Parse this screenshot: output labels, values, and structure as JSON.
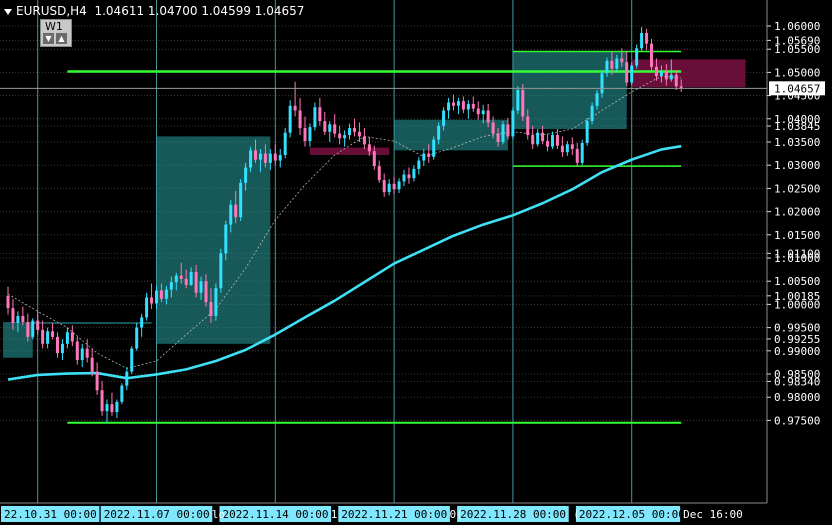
{
  "header": {
    "symbol_timeframe": "EURUSD,H4",
    "ohlc": "1.04611 1.04700 1.04599 1.04657"
  },
  "period_widget": {
    "label": "W1",
    "down_arrow": "▼",
    "up_arrow": "▲"
  },
  "colors": {
    "background": "#000000",
    "grid": "#5ec8d8",
    "bull": "#33e0ff",
    "bear": "#ff77bb",
    "ma": "#3ee0f5",
    "level": "#33ff33",
    "box_teal": "#2aa0a0",
    "box_maroon": "#7a1042",
    "axis_text": "#ffffff"
  },
  "chart_data": {
    "type": "candlestick",
    "symbol": "EURUSD",
    "timeframe": "H4",
    "ylim": [
      0.9712,
      1.0622
    ],
    "y_ticks": [
      {
        "value": 1.06,
        "label": "1.06000"
      },
      {
        "value": 1.0569,
        "label": "1.05690"
      },
      {
        "value": 1.055,
        "label": "1.05500"
      },
      {
        "value": 1.05,
        "label": "1.05000"
      },
      {
        "value": 1.045,
        "label": "1.04500"
      },
      {
        "value": 1.04,
        "label": "1.04000"
      },
      {
        "value": 1.03845,
        "label": "1.03845"
      },
      {
        "value": 1.035,
        "label": "1.03500"
      },
      {
        "value": 1.03,
        "label": "1.03000"
      },
      {
        "value": 1.025,
        "label": "1.02500"
      },
      {
        "value": 1.02,
        "label": "1.02000"
      },
      {
        "value": 1.015,
        "label": "1.01500"
      },
      {
        "value": 1.011,
        "label": "1.01100"
      },
      {
        "value": 1.01,
        "label": "1.01000"
      },
      {
        "value": 1.005,
        "label": "1.00500"
      },
      {
        "value": 1.00185,
        "label": "1.00185"
      },
      {
        "value": 1.0,
        "label": "1.00000"
      },
      {
        "value": 0.995,
        "label": "0.99500"
      },
      {
        "value": 0.99255,
        "label": "0.99255"
      },
      {
        "value": 0.99,
        "label": "0.99000"
      },
      {
        "value": 0.985,
        "label": "0.98500"
      },
      {
        "value": 0.9834,
        "label": "0.98340"
      },
      {
        "value": 0.98,
        "label": "0.98000"
      },
      {
        "value": 0.975,
        "label": "0.97500"
      }
    ],
    "current_price": {
      "value": 1.04657,
      "label": "1.04657"
    },
    "x_ticks": [
      {
        "index": 6,
        "label": "22.10.31 00:00"
      },
      {
        "index": 30,
        "label": "2022.11.07 00:00"
      },
      {
        "index": 54,
        "label": "2022.11.14 00:00"
      },
      {
        "index": 78,
        "label": "2022.11.21 00:00"
      },
      {
        "index": 102,
        "label": "2022.11.28 00:00"
      },
      {
        "index": 126,
        "label": "2022.12.05 00:00"
      },
      {
        "index": 137,
        "label": "Dec 16:00"
      }
    ],
    "x_partial_labels": [
      {
        "index": 42,
        "label": "lo"
      },
      {
        "index": 66,
        "label": "1"
      },
      {
        "index": 90,
        "label": "0("
      },
      {
        "index": 115,
        "label": "("
      }
    ],
    "grid_vertical_indices": [
      6,
      30,
      54,
      78,
      102,
      126
    ],
    "candles": [
      [
        1.0018,
        1.0038,
        0.9978,
        0.9992
      ],
      [
        0.9992,
        1.0012,
        0.9945,
        0.996
      ],
      [
        0.996,
        0.9985,
        0.994,
        0.9975
      ],
      [
        0.9975,
        0.9995,
        0.9955,
        0.9962
      ],
      [
        0.9962,
        0.998,
        0.992,
        0.993
      ],
      [
        0.993,
        0.997,
        0.9925,
        0.9965
      ],
      [
        0.9965,
        0.9985,
        0.9935,
        0.9945
      ],
      [
        0.9945,
        0.9965,
        0.9905,
        0.9915
      ],
      [
        0.9915,
        0.995,
        0.9905,
        0.9942
      ],
      [
        0.9942,
        0.996,
        0.9925,
        0.993
      ],
      [
        0.993,
        0.994,
        0.9885,
        0.9895
      ],
      [
        0.9895,
        0.9925,
        0.988,
        0.9915
      ],
      [
        0.9915,
        0.995,
        0.9905,
        0.994
      ],
      [
        0.994,
        0.9955,
        0.991,
        0.992
      ],
      [
        0.992,
        0.993,
        0.987,
        0.988
      ],
      [
        0.988,
        0.9915,
        0.9865,
        0.9905
      ],
      [
        0.9905,
        0.9925,
        0.9875,
        0.9885
      ],
      [
        0.9885,
        0.9905,
        0.9845,
        0.9855
      ],
      [
        0.9855,
        0.9875,
        0.9805,
        0.9815
      ],
      [
        0.9815,
        0.9835,
        0.976,
        0.977
      ],
      [
        0.977,
        0.9795,
        0.9745,
        0.9785
      ],
      [
        0.9785,
        0.981,
        0.976,
        0.9768
      ],
      [
        0.9768,
        0.9795,
        0.9755,
        0.979
      ],
      [
        0.979,
        0.983,
        0.9785,
        0.9825
      ],
      [
        0.9825,
        0.9865,
        0.9815,
        0.9855
      ],
      [
        0.9855,
        0.991,
        0.985,
        0.9905
      ],
      [
        0.9905,
        0.996,
        0.99,
        0.995
      ],
      [
        0.995,
        0.998,
        0.993,
        0.9972
      ],
      [
        0.9972,
        1.0025,
        0.9965,
        1.0015
      ],
      [
        1.0015,
        1.0045,
        0.999,
        1.0002
      ],
      [
        1.0002,
        1.004,
        0.999,
        1.003
      ],
      [
        1.003,
        1.0045,
        1.0005,
        1.0012
      ],
      [
        1.0012,
        1.004,
        1.0,
        1.0032
      ],
      [
        1.0032,
        1.006,
        1.0015,
        1.0048
      ],
      [
        1.0048,
        1.0068,
        1.003,
        1.0062
      ],
      [
        1.0062,
        1.009,
        1.0045,
        1.0055
      ],
      [
        1.0055,
        1.0075,
        1.0035,
        1.0042
      ],
      [
        1.0042,
        1.008,
        1.004,
        1.007
      ],
      [
        1.007,
        1.0085,
        1.0015,
        1.0025
      ],
      [
        1.0025,
        1.006,
        1.001,
        1.005
      ],
      [
        1.005,
        1.0065,
        0.9995,
        1.0005
      ],
      [
        1.0005,
        1.0035,
        0.996,
        0.9975
      ],
      [
        0.9975,
        1.0045,
        0.9965,
        1.0035
      ],
      [
        1.0035,
        1.012,
        1.0025,
        1.011
      ],
      [
        1.011,
        1.018,
        1.0095,
        1.0172
      ],
      [
        1.0172,
        1.0225,
        1.0155,
        1.0215
      ],
      [
        1.0215,
        1.0245,
        1.0175,
        1.0188
      ],
      [
        1.0188,
        1.027,
        1.018,
        1.0262
      ],
      [
        1.0262,
        1.0305,
        1.0245,
        1.0295
      ],
      [
        1.0295,
        1.034,
        1.0285,
        1.0332
      ],
      [
        1.0332,
        1.0355,
        1.0305,
        1.0312
      ],
      [
        1.0312,
        1.0335,
        1.0285,
        1.0325
      ],
      [
        1.0325,
        1.0345,
        1.0295,
        1.0305
      ],
      [
        1.0305,
        1.0335,
        1.029,
        1.0325
      ],
      [
        1.0325,
        1.0345,
        1.03,
        1.031
      ],
      [
        1.031,
        1.0335,
        1.0295,
        1.0322
      ],
      [
        1.0322,
        1.038,
        1.0315,
        1.037
      ],
      [
        1.037,
        1.044,
        1.036,
        1.0428
      ],
      [
        1.0428,
        1.048,
        1.0405,
        1.0418
      ],
      [
        1.0418,
        1.0445,
        1.0365,
        1.038
      ],
      [
        1.038,
        1.0405,
        1.034,
        1.0352
      ],
      [
        1.0352,
        1.039,
        1.034,
        1.0382
      ],
      [
        1.0382,
        1.0435,
        1.0375,
        1.0425
      ],
      [
        1.0425,
        1.0445,
        1.0385,
        1.0395
      ],
      [
        1.0395,
        1.0415,
        1.0365,
        1.0372
      ],
      [
        1.0372,
        1.0395,
        1.035,
        1.0388
      ],
      [
        1.0388,
        1.041,
        1.036,
        1.0368
      ],
      [
        1.0368,
        1.0385,
        1.0345,
        1.0358
      ],
      [
        1.0358,
        1.0375,
        1.034,
        1.0365
      ],
      [
        1.0365,
        1.039,
        1.0355,
        1.038
      ],
      [
        1.038,
        1.04,
        1.0362,
        1.0372
      ],
      [
        1.0372,
        1.0392,
        1.035,
        1.0362
      ],
      [
        1.0362,
        1.038,
        1.0335,
        1.0345
      ],
      [
        1.0345,
        1.036,
        1.032,
        1.033
      ],
      [
        1.033,
        1.0342,
        1.029,
        1.0298
      ],
      [
        1.0298,
        1.031,
        1.0262,
        1.0268
      ],
      [
        1.0268,
        1.0282,
        1.0232,
        1.0242
      ],
      [
        1.0242,
        1.027,
        1.0235,
        1.026
      ],
      [
        1.026,
        1.0275,
        1.0238,
        1.0248
      ],
      [
        1.0248,
        1.0272,
        1.024,
        1.0265
      ],
      [
        1.0265,
        1.029,
        1.0255,
        1.028
      ],
      [
        1.028,
        1.0295,
        1.026,
        1.0272
      ],
      [
        1.0272,
        1.03,
        1.0265,
        1.0292
      ],
      [
        1.0292,
        1.0318,
        1.028,
        1.031
      ],
      [
        1.031,
        1.0335,
        1.0298,
        1.0325
      ],
      [
        1.0325,
        1.0345,
        1.0305,
        1.0318
      ],
      [
        1.0318,
        1.0362,
        1.0312,
        1.0355
      ],
      [
        1.0355,
        1.0392,
        1.0345,
        1.0385
      ],
      [
        1.0385,
        1.0425,
        1.0375,
        1.0418
      ],
      [
        1.0418,
        1.0445,
        1.04,
        1.0435
      ],
      [
        1.0435,
        1.0452,
        1.0418,
        1.0428
      ],
      [
        1.0428,
        1.0445,
        1.041,
        1.0438
      ],
      [
        1.0438,
        1.0448,
        1.0412,
        1.042
      ],
      [
        1.042,
        1.044,
        1.04,
        1.0432
      ],
      [
        1.0432,
        1.0448,
        1.0415,
        1.0422
      ],
      [
        1.0422,
        1.0438,
        1.0398,
        1.041
      ],
      [
        1.041,
        1.043,
        1.039,
        1.0418
      ],
      [
        1.0418,
        1.0432,
        1.0382,
        1.0392
      ],
      [
        1.0392,
        1.0405,
        1.0358,
        1.0368
      ],
      [
        1.0368,
        1.038,
        1.034,
        1.035
      ],
      [
        1.035,
        1.0395,
        1.0345,
        1.0388
      ],
      [
        1.0388,
        1.0402,
        1.0355,
        1.0362
      ],
      [
        1.0362,
        1.0425,
        1.0355,
        1.0418
      ],
      [
        1.0418,
        1.047,
        1.041,
        1.0462
      ],
      [
        1.0462,
        1.0475,
        1.0395,
        1.0405
      ],
      [
        1.0405,
        1.042,
        1.0355,
        1.0365
      ],
      [
        1.0365,
        1.0385,
        1.0335,
        1.0345
      ],
      [
        1.0345,
        1.0378,
        1.034,
        1.037
      ],
      [
        1.037,
        1.0385,
        1.0345,
        1.0352
      ],
      [
        1.0352,
        1.0368,
        1.033,
        1.034
      ],
      [
        1.034,
        1.0372,
        1.0335,
        1.0365
      ],
      [
        1.0365,
        1.0378,
        1.0335,
        1.0342
      ],
      [
        1.0342,
        1.0362,
        1.0318,
        1.0328
      ],
      [
        1.0328,
        1.0352,
        1.032,
        1.0345
      ],
      [
        1.0345,
        1.036,
        1.0322,
        1.0335
      ],
      [
        1.0335,
        1.0348,
        1.0298,
        1.0305
      ],
      [
        1.0305,
        1.0355,
        1.03,
        1.0348
      ],
      [
        1.0348,
        1.0402,
        1.0342,
        1.0395
      ],
      [
        1.0395,
        1.0435,
        1.0388,
        1.0428
      ],
      [
        1.0428,
        1.0462,
        1.042,
        1.0455
      ],
      [
        1.0455,
        1.0505,
        1.0445,
        1.0498
      ],
      [
        1.0498,
        1.0532,
        1.049,
        1.0525
      ],
      [
        1.0525,
        1.0545,
        1.0495,
        1.0508
      ],
      [
        1.0508,
        1.0538,
        1.05,
        1.053
      ],
      [
        1.053,
        1.0552,
        1.0512,
        1.0522
      ],
      [
        1.0522,
        1.0545,
        1.047,
        1.0478
      ],
      [
        1.0478,
        1.0522,
        1.0472,
        1.0515
      ],
      [
        1.0515,
        1.056,
        1.0508,
        1.0552
      ],
      [
        1.0552,
        1.0598,
        1.0545,
        1.0585
      ],
      [
        1.0585,
        1.0594,
        1.0548,
        1.0562
      ],
      [
        1.0562,
        1.0572,
        1.0502,
        1.0512
      ],
      [
        1.0512,
        1.053,
        1.0482,
        1.0492
      ],
      [
        1.0492,
        1.0515,
        1.0478,
        1.0502
      ],
      [
        1.0502,
        1.0518,
        1.0472,
        1.0485
      ],
      [
        1.0485,
        1.0528,
        1.048,
        1.0495
      ],
      [
        1.0495,
        1.0505,
        1.0462,
        1.047
      ],
      [
        1.047,
        1.0485,
        1.0458,
        1.0466
      ]
    ],
    "ma": [
      [
        0,
        0.9838
      ],
      [
        6,
        0.9848
      ],
      [
        12,
        0.9851
      ],
      [
        18,
        0.9852
      ],
      [
        24,
        0.9841
      ],
      [
        30,
        0.9849
      ],
      [
        36,
        0.986
      ],
      [
        42,
        0.9878
      ],
      [
        48,
        0.9902
      ],
      [
        54,
        0.9935
      ],
      [
        60,
        0.9972
      ],
      [
        66,
        1.0008
      ],
      [
        72,
        1.0048
      ],
      [
        78,
        1.0088
      ],
      [
        84,
        1.0118
      ],
      [
        90,
        1.0148
      ],
      [
        96,
        1.0172
      ],
      [
        102,
        1.0192
      ],
      [
        108,
        1.0218
      ],
      [
        114,
        1.0248
      ],
      [
        120,
        1.0285
      ],
      [
        126,
        1.0312
      ],
      [
        132,
        1.0334
      ],
      [
        136,
        1.0341
      ]
    ],
    "signal_line": [
      [
        0,
        1.0022
      ],
      [
        6,
        0.9985
      ],
      [
        12,
        0.995
      ],
      [
        18,
        0.9895
      ],
      [
        24,
        0.9862
      ],
      [
        30,
        0.9878
      ],
      [
        36,
        0.9935
      ],
      [
        42,
        0.999
      ],
      [
        48,
        1.0078
      ],
      [
        54,
        1.0182
      ],
      [
        60,
        1.0258
      ],
      [
        66,
        1.0322
      ],
      [
        72,
        1.0362
      ],
      [
        78,
        1.0352
      ],
      [
        84,
        1.0318
      ],
      [
        90,
        1.0338
      ],
      [
        96,
        1.0362
      ],
      [
        102,
        1.0372
      ],
      [
        108,
        1.0365
      ],
      [
        114,
        1.0378
      ],
      [
        120,
        1.0418
      ],
      [
        126,
        1.0458
      ],
      [
        132,
        1.0492
      ],
      [
        136,
        1.0488
      ]
    ],
    "levels": [
      {
        "value": 1.0502,
        "from": 12,
        "to": 136,
        "width": 2.5
      },
      {
        "value": 1.0545,
        "from": 102,
        "to": 136,
        "width": 1.5
      },
      {
        "value": 1.0298,
        "from": 102,
        "to": 136,
        "width": 1.5
      },
      {
        "value": 0.9745,
        "from": 12,
        "to": 136,
        "width": 2
      }
    ],
    "boxes": [
      {
        "kind": "teal",
        "from": -1,
        "to": 5,
        "top": 0.9962,
        "bottom": 0.9885
      },
      {
        "kind": "teal",
        "from": 5,
        "to": 29,
        "top": 0.9962,
        "bottom": 0.9958
      },
      {
        "kind": "teal",
        "from": 30,
        "to": 53,
        "top": 1.0362,
        "bottom": 0.9915
      },
      {
        "kind": "teal",
        "from": 78,
        "to": 101,
        "top": 1.0398,
        "bottom": 1.0332
      },
      {
        "kind": "teal",
        "from": 102,
        "to": 125,
        "top": 1.0545,
        "bottom": 1.0378
      },
      {
        "kind": "maroon",
        "from": 61,
        "to": 77,
        "top": 1.0338,
        "bottom": 1.0322
      },
      {
        "kind": "maroon",
        "from": 126,
        "to": 149,
        "top": 1.0528,
        "bottom": 1.0468
      }
    ]
  }
}
